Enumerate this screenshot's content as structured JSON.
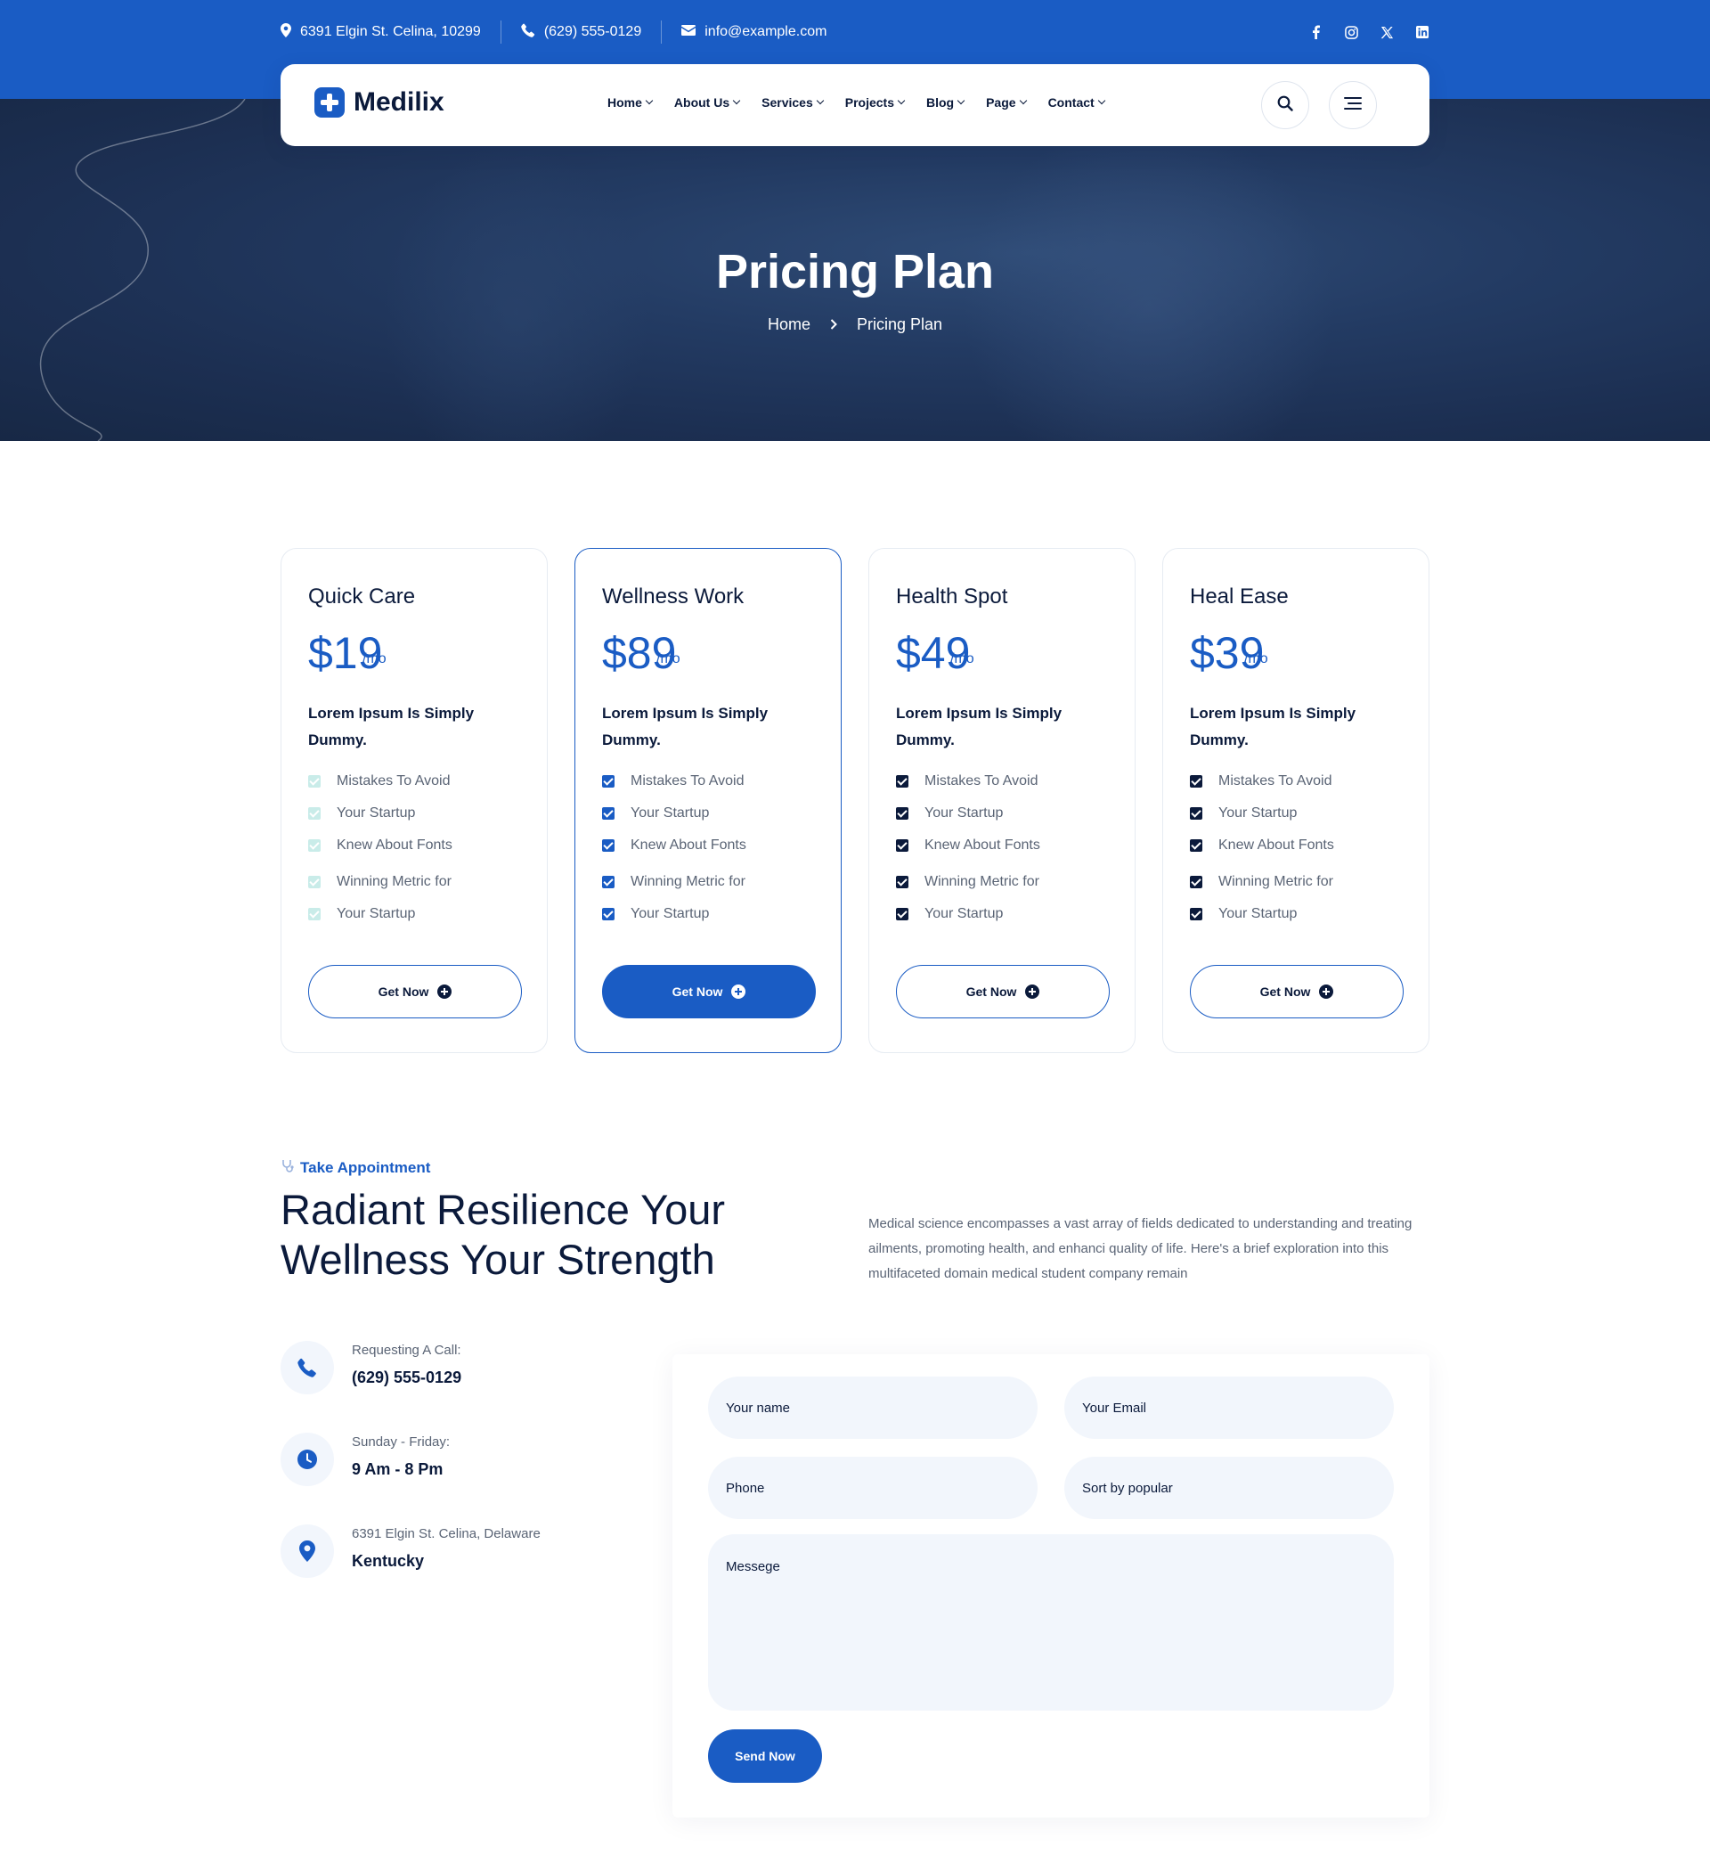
{
  "topbar": {
    "address": "6391 Elgin St. Celina, 10299",
    "phone": "(629) 555-0129",
    "email": "info@example.com",
    "social_icons": [
      "facebook-icon",
      "instagram-icon",
      "x-icon",
      "linkedin-icon"
    ]
  },
  "nav": {
    "logo_text": "Medilix",
    "items": [
      {
        "label": "Home"
      },
      {
        "label": "About Us"
      },
      {
        "label": "Services"
      },
      {
        "label": "Projects"
      },
      {
        "label": "Blog"
      },
      {
        "label": "Page"
      },
      {
        "label": "Contact"
      }
    ]
  },
  "hero": {
    "title": "Pricing Plan",
    "breadcrumb": {
      "home": "Home",
      "current": "Pricing Plan"
    }
  },
  "pricing": [
    {
      "title": "Quick Care",
      "price": "$19",
      "period": "/mo",
      "subtitle": "Lorem Ipsum Is Simply Dummy.",
      "features": [
        "Mistakes To Avoid",
        "Your Startup",
        "Knew About Fonts",
        "Winning Metric for",
        "Your Startup"
      ],
      "button": "Get Now"
    },
    {
      "title": "Wellness Work",
      "price": "$89",
      "period": "/mo",
      "subtitle": "Lorem Ipsum Is Simply Dummy.",
      "features": [
        "Mistakes To Avoid",
        "Your Startup",
        "Knew About Fonts",
        "Winning Metric for",
        "Your Startup"
      ],
      "button": "Get Now"
    },
    {
      "title": "Health Spot",
      "price": "$49",
      "period": "/mo",
      "subtitle": "Lorem Ipsum Is Simply Dummy.",
      "features": [
        "Mistakes To Avoid",
        "Your Startup",
        "Knew About Fonts",
        "Winning Metric for",
        "Your Startup"
      ],
      "button": "Get Now"
    },
    {
      "title": "Heal Ease",
      "price": "$39",
      "period": "/mo",
      "subtitle": "Lorem Ipsum Is Simply Dummy.",
      "features": [
        "Mistakes To Avoid",
        "Your Startup",
        "Knew About Fonts",
        "Winning Metric for",
        "Your Startup"
      ],
      "button": "Get Now"
    }
  ],
  "appointment": {
    "kicker": "Take Appointment",
    "title": "Radiant Resilience Your Wellness Your Strength",
    "description": "Medical science encompasses a vast array of fields dedicated to understanding and treating ailments, promoting health, and enhanci quality of life. Here's a brief exploration into this multifaceted domain medical student company remain",
    "info": [
      {
        "label": "Requesting A Call:",
        "value": "(629) 555-0129"
      },
      {
        "label": "Sunday - Friday:",
        "value": "9 Am - 8 Pm"
      },
      {
        "label": "6391 Elgin St. Celina, Delaware",
        "value": "Kentucky"
      }
    ],
    "form": {
      "name_placeholder": "Your name",
      "email_placeholder": "Your Email",
      "phone_placeholder": "Phone",
      "sort_value": "Sort by popular",
      "message_placeholder": "Messege",
      "submit": "Send Now"
    }
  },
  "colors": {
    "primary": "#1a5cc4",
    "navy": "#0b1a3b",
    "hero_overlay": "#1f355b",
    "field_bg": "#f2f6fc",
    "light_check": "#c9ece9"
  }
}
